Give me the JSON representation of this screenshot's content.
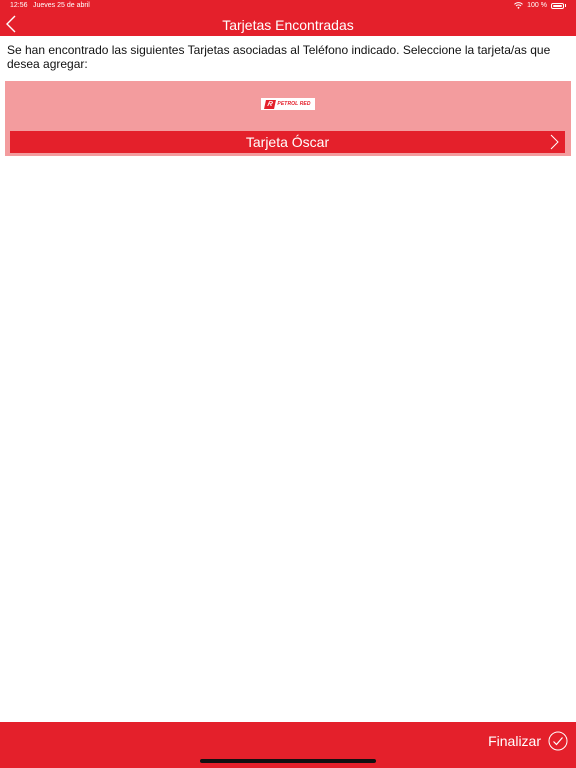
{
  "status": {
    "time": "12:56",
    "date": "Jueves 25 de abril",
    "battery": "100 %",
    "icons": [
      "wifi-icon",
      "battery-icon"
    ]
  },
  "nav": {
    "title": "Tarjetas Encontradas",
    "back_icon": "chevron-left-icon"
  },
  "content": {
    "description": "Se han encontrado las siguientes Tarjetas asociadas al Teléfono indicado. Seleccione la tarjeta/as que desea agregar:",
    "cards": [
      {
        "brand": "PETROL RED",
        "brand_mark": "R",
        "label": "Tarjeta Óscar",
        "icon": "chevron-right-icon"
      }
    ]
  },
  "footer": {
    "finalize_label": "Finalizar",
    "finalize_icon": "check-circle-icon"
  },
  "colors": {
    "primary": "#e4202b",
    "card_background": "#f39c9e",
    "background": "#ffffff"
  }
}
